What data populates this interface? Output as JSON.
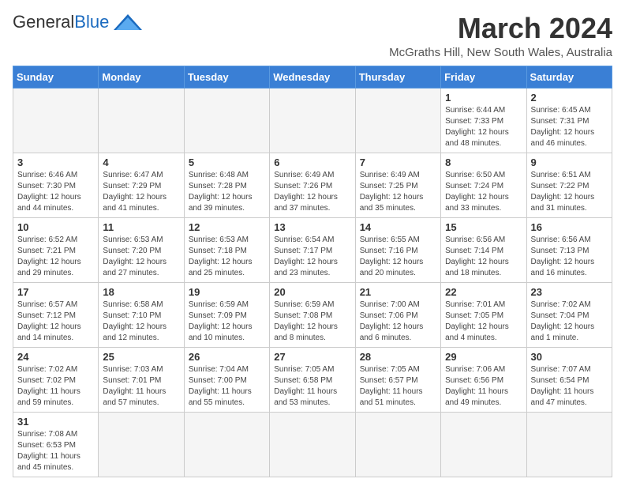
{
  "header": {
    "logo_general": "General",
    "logo_blue": "Blue",
    "month_title": "March 2024",
    "location": "McGraths Hill, New South Wales, Australia"
  },
  "weekdays": [
    "Sunday",
    "Monday",
    "Tuesday",
    "Wednesday",
    "Thursday",
    "Friday",
    "Saturday"
  ],
  "weeks": [
    [
      {
        "day": "",
        "info": ""
      },
      {
        "day": "",
        "info": ""
      },
      {
        "day": "",
        "info": ""
      },
      {
        "day": "",
        "info": ""
      },
      {
        "day": "",
        "info": ""
      },
      {
        "day": "1",
        "info": "Sunrise: 6:44 AM\nSunset: 7:33 PM\nDaylight: 12 hours\nand 48 minutes."
      },
      {
        "day": "2",
        "info": "Sunrise: 6:45 AM\nSunset: 7:31 PM\nDaylight: 12 hours\nand 46 minutes."
      }
    ],
    [
      {
        "day": "3",
        "info": "Sunrise: 6:46 AM\nSunset: 7:30 PM\nDaylight: 12 hours\nand 44 minutes."
      },
      {
        "day": "4",
        "info": "Sunrise: 6:47 AM\nSunset: 7:29 PM\nDaylight: 12 hours\nand 41 minutes."
      },
      {
        "day": "5",
        "info": "Sunrise: 6:48 AM\nSunset: 7:28 PM\nDaylight: 12 hours\nand 39 minutes."
      },
      {
        "day": "6",
        "info": "Sunrise: 6:49 AM\nSunset: 7:26 PM\nDaylight: 12 hours\nand 37 minutes."
      },
      {
        "day": "7",
        "info": "Sunrise: 6:49 AM\nSunset: 7:25 PM\nDaylight: 12 hours\nand 35 minutes."
      },
      {
        "day": "8",
        "info": "Sunrise: 6:50 AM\nSunset: 7:24 PM\nDaylight: 12 hours\nand 33 minutes."
      },
      {
        "day": "9",
        "info": "Sunrise: 6:51 AM\nSunset: 7:22 PM\nDaylight: 12 hours\nand 31 minutes."
      }
    ],
    [
      {
        "day": "10",
        "info": "Sunrise: 6:52 AM\nSunset: 7:21 PM\nDaylight: 12 hours\nand 29 minutes."
      },
      {
        "day": "11",
        "info": "Sunrise: 6:53 AM\nSunset: 7:20 PM\nDaylight: 12 hours\nand 27 minutes."
      },
      {
        "day": "12",
        "info": "Sunrise: 6:53 AM\nSunset: 7:18 PM\nDaylight: 12 hours\nand 25 minutes."
      },
      {
        "day": "13",
        "info": "Sunrise: 6:54 AM\nSunset: 7:17 PM\nDaylight: 12 hours\nand 23 minutes."
      },
      {
        "day": "14",
        "info": "Sunrise: 6:55 AM\nSunset: 7:16 PM\nDaylight: 12 hours\nand 20 minutes."
      },
      {
        "day": "15",
        "info": "Sunrise: 6:56 AM\nSunset: 7:14 PM\nDaylight: 12 hours\nand 18 minutes."
      },
      {
        "day": "16",
        "info": "Sunrise: 6:56 AM\nSunset: 7:13 PM\nDaylight: 12 hours\nand 16 minutes."
      }
    ],
    [
      {
        "day": "17",
        "info": "Sunrise: 6:57 AM\nSunset: 7:12 PM\nDaylight: 12 hours\nand 14 minutes."
      },
      {
        "day": "18",
        "info": "Sunrise: 6:58 AM\nSunset: 7:10 PM\nDaylight: 12 hours\nand 12 minutes."
      },
      {
        "day": "19",
        "info": "Sunrise: 6:59 AM\nSunset: 7:09 PM\nDaylight: 12 hours\nand 10 minutes."
      },
      {
        "day": "20",
        "info": "Sunrise: 6:59 AM\nSunset: 7:08 PM\nDaylight: 12 hours\nand 8 minutes."
      },
      {
        "day": "21",
        "info": "Sunrise: 7:00 AM\nSunset: 7:06 PM\nDaylight: 12 hours\nand 6 minutes."
      },
      {
        "day": "22",
        "info": "Sunrise: 7:01 AM\nSunset: 7:05 PM\nDaylight: 12 hours\nand 4 minutes."
      },
      {
        "day": "23",
        "info": "Sunrise: 7:02 AM\nSunset: 7:04 PM\nDaylight: 12 hours\nand 1 minute."
      }
    ],
    [
      {
        "day": "24",
        "info": "Sunrise: 7:02 AM\nSunset: 7:02 PM\nDaylight: 11 hours\nand 59 minutes."
      },
      {
        "day": "25",
        "info": "Sunrise: 7:03 AM\nSunset: 7:01 PM\nDaylight: 11 hours\nand 57 minutes."
      },
      {
        "day": "26",
        "info": "Sunrise: 7:04 AM\nSunset: 7:00 PM\nDaylight: 11 hours\nand 55 minutes."
      },
      {
        "day": "27",
        "info": "Sunrise: 7:05 AM\nSunset: 6:58 PM\nDaylight: 11 hours\nand 53 minutes."
      },
      {
        "day": "28",
        "info": "Sunrise: 7:05 AM\nSunset: 6:57 PM\nDaylight: 11 hours\nand 51 minutes."
      },
      {
        "day": "29",
        "info": "Sunrise: 7:06 AM\nSunset: 6:56 PM\nDaylight: 11 hours\nand 49 minutes."
      },
      {
        "day": "30",
        "info": "Sunrise: 7:07 AM\nSunset: 6:54 PM\nDaylight: 11 hours\nand 47 minutes."
      }
    ],
    [
      {
        "day": "31",
        "info": "Sunrise: 7:08 AM\nSunset: 6:53 PM\nDaylight: 11 hours\nand 45 minutes."
      },
      {
        "day": "",
        "info": ""
      },
      {
        "day": "",
        "info": ""
      },
      {
        "day": "",
        "info": ""
      },
      {
        "day": "",
        "info": ""
      },
      {
        "day": "",
        "info": ""
      },
      {
        "day": "",
        "info": ""
      }
    ]
  ]
}
